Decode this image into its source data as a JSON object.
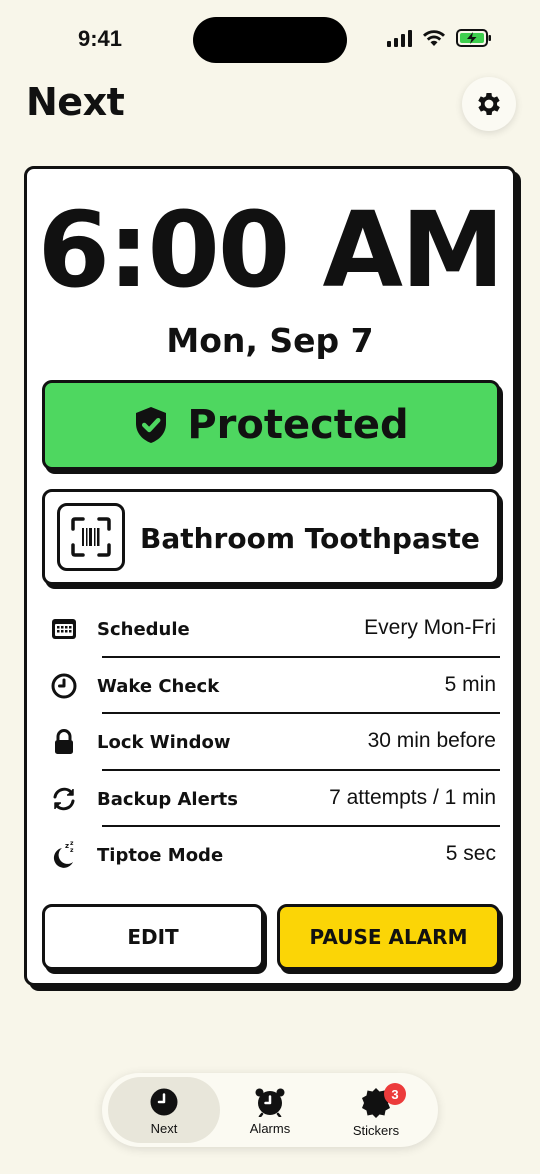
{
  "status_bar": {
    "time": "9:41"
  },
  "header": {
    "title": "Next"
  },
  "alarm": {
    "time": "6:00 AM",
    "date": "Mon, Sep 7",
    "status_label": "Protected",
    "barcode_label": "Bathroom Toothpaste"
  },
  "settings": [
    {
      "icon": "calendar-icon",
      "label": "Schedule",
      "value": "Every Mon-Fri"
    },
    {
      "icon": "clock-icon",
      "label": "Wake Check",
      "value": "5 min"
    },
    {
      "icon": "lock-icon",
      "label": "Lock Window",
      "value": "30 min before"
    },
    {
      "icon": "refresh-icon",
      "label": "Backup Alerts",
      "value": "7 attempts / 1 min"
    },
    {
      "icon": "moon-sleep-icon",
      "label": "Tiptoe Mode",
      "value": "5 sec"
    }
  ],
  "actions": {
    "edit_label": "EDIT",
    "pause_label": "PAUSE ALARM"
  },
  "tabs": [
    {
      "label": "Next",
      "icon": "clock-icon",
      "active": true
    },
    {
      "label": "Alarms",
      "icon": "alarm-clock-icon",
      "active": false
    },
    {
      "label": "Stickers",
      "icon": "badge-seal-icon",
      "active": false,
      "badge": "3"
    }
  ],
  "colors": {
    "background": "#f8f6ea",
    "protected": "#4ed760",
    "pause": "#fbd506",
    "badge": "#ec3b3b"
  }
}
